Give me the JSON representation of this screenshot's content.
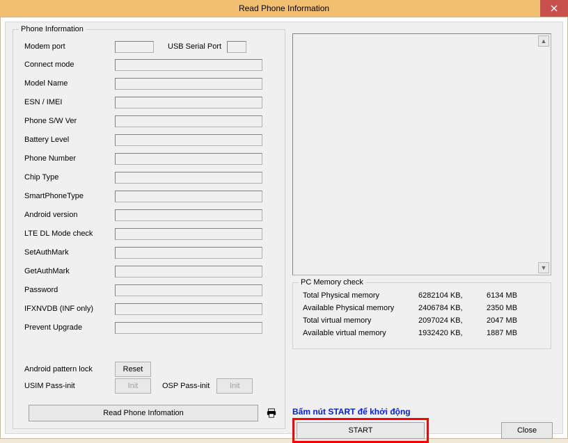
{
  "window": {
    "title": "Read Phone Information"
  },
  "phoneInfo": {
    "legend": "Phone Information",
    "labels": {
      "modemPort": "Modem port",
      "usbSerial": "USB Serial Port",
      "connectMode": "Connect mode",
      "modelName": "Model Name",
      "esnImei": "ESN / IMEI",
      "phoneSwVer": "Phone S/W Ver",
      "batteryLevel": "Battery Level",
      "phoneNumber": "Phone Number",
      "chipType": "Chip Type",
      "smartPhoneType": "SmartPhoneType",
      "androidVersion": "Android version",
      "lteDlMode": "LTE DL Mode check",
      "setAuthMark": "SetAuthMark",
      "getAuthMark": "GetAuthMark",
      "password": "Password",
      "ifxnvdb": "IFXNVDB (INF only)",
      "preventUpgrade": "Prevent Upgrade",
      "androidPatternLock": "Android pattern lock",
      "usimPassInit": "USIM Pass-init",
      "ospPassInit": "OSP Pass-init"
    },
    "buttons": {
      "reset": "Reset",
      "init1": "Init",
      "init2": "Init",
      "readPhone": "Read Phone Infomation"
    }
  },
  "pcMem": {
    "legend": "PC Memory check",
    "rows": [
      {
        "label": "Total Physical memory",
        "kb": "6282104 KB,",
        "mb": "6134 MB"
      },
      {
        "label": "Available Physical memory",
        "kb": "2406784 KB,",
        "mb": "2350 MB"
      },
      {
        "label": "Total virtual memory",
        "kb": "2097024 KB,",
        "mb": "2047 MB"
      },
      {
        "label": "Available virtual memory",
        "kb": "1932420 KB,",
        "mb": "1887 MB"
      }
    ]
  },
  "annot": "Bấm nút START để khởi động",
  "buttons": {
    "start": "START",
    "close": "Close"
  }
}
